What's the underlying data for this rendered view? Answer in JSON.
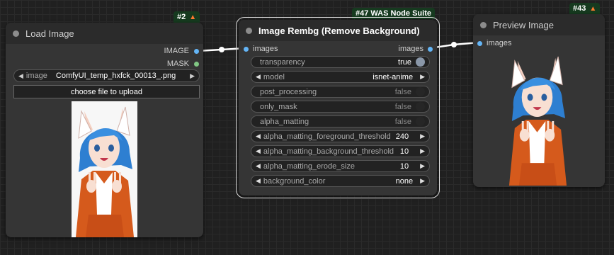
{
  "load_image": {
    "badge": "#2",
    "title": "Load Image",
    "outputs": [
      "IMAGE",
      "MASK"
    ],
    "image_widget": {
      "name": "image",
      "value": "ComfyUI_temp_hxfck_00013_.png"
    },
    "upload_label": "choose file to upload"
  },
  "rembg": {
    "badge": "#47 WAS Node Suite",
    "title": "Image Rembg (Remove Background)",
    "input": "images",
    "output": "images",
    "widgets": [
      {
        "name": "transparency",
        "value": "true",
        "kind": "toggle",
        "on": true
      },
      {
        "name": "model",
        "value": "isnet-anime",
        "kind": "combo"
      },
      {
        "name": "post_processing",
        "value": "false",
        "kind": "toggle",
        "on": false
      },
      {
        "name": "only_mask",
        "value": "false",
        "kind": "toggle",
        "on": false
      },
      {
        "name": "alpha_matting",
        "value": "false",
        "kind": "toggle",
        "on": false
      },
      {
        "name": "alpha_matting_foreground_threshold",
        "value": "240",
        "kind": "number"
      },
      {
        "name": "alpha_matting_background_threshold",
        "value": "10",
        "kind": "number"
      },
      {
        "name": "alpha_matting_erode_size",
        "value": "10",
        "kind": "number"
      },
      {
        "name": "background_color",
        "value": "none",
        "kind": "combo"
      }
    ]
  },
  "preview": {
    "badge": "#43",
    "title": "Preview Image",
    "input": "images"
  },
  "colors": {
    "canvas": "#202020",
    "node_body": "#353535",
    "node_title": "#2b2b2b",
    "badge": "#163a1f",
    "image_slot": "#64b5f6",
    "mask_slot": "#81c784",
    "link": "#ffffff"
  },
  "icons": [
    "fox-icon",
    "node-status-dot",
    "left-arrow",
    "right-arrow"
  ]
}
